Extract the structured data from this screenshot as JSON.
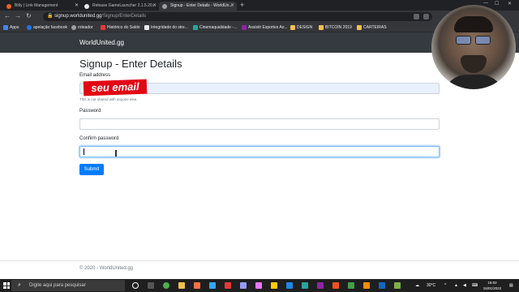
{
  "browser": {
    "tabs": [
      {
        "label": "Bitly | Link Management",
        "active": false
      },
      {
        "label": "Release GameLauncher 2.1.5.20...",
        "active": false
      },
      {
        "label": "Signup - Enter Details - WorldUn...",
        "active": true
      }
    ],
    "new_tab": "+",
    "url_host": "signup.worldunited.gg",
    "url_path": "/Signup/EnterDetails",
    "bookmarks": [
      "Apps",
      "apelação facebook",
      "roteador",
      "Histórico do Saldo",
      "Integridade do stre...",
      "Cinemaqualidade -...",
      "Assistir Esportes Ao...",
      "DESIGN",
      "BITCOIN 2019",
      "CARTEIRAS"
    ]
  },
  "navbar": {
    "brand": "WorldUnited.gg"
  },
  "form": {
    "title": "Signup - Enter Details",
    "email_label": "Email address",
    "email_overlay": "seu email",
    "email_help": "This is not shared with anyone else.",
    "password_label": "Password",
    "confirm_label": "Confirm password",
    "submit_label": "Submit"
  },
  "footer": {
    "text": "© 2020 - WorldUnited.gg"
  },
  "taskbar": {
    "search_placeholder": "Digite aqui para pesquisar",
    "weather": "30°C",
    "time": "15:02",
    "date": "16/01/2022"
  },
  "colors": {
    "navbar": "#343a40",
    "primary": "#007bff",
    "overlay": "#e30613"
  }
}
